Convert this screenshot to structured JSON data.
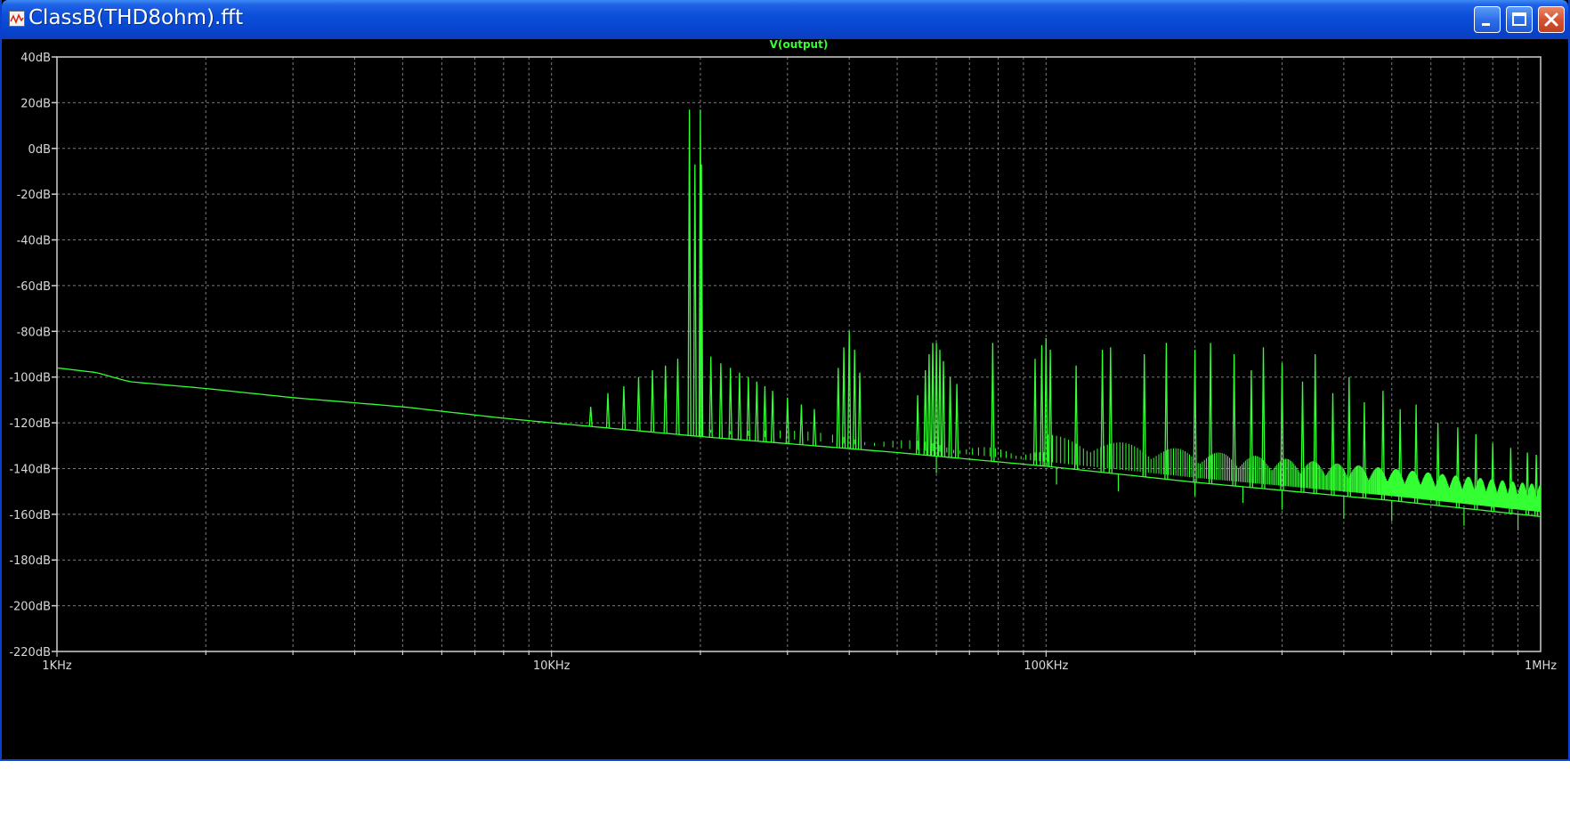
{
  "window": {
    "title": "ClassB(THD8ohm).fft"
  },
  "chart_data": {
    "type": "line",
    "title": "V(output)",
    "xlabel": "",
    "ylabel": "",
    "x_scale": "log",
    "xlim": [
      1000,
      1000000
    ],
    "ylim": [
      -220,
      40
    ],
    "x_ticks": [
      {
        "value": 1000,
        "label": "1KHz"
      },
      {
        "value": 10000,
        "label": "10KHz"
      },
      {
        "value": 100000,
        "label": "100KHz"
      },
      {
        "value": 1000000,
        "label": "1MHz"
      }
    ],
    "y_ticks": [
      {
        "value": 40,
        "label": "40dB"
      },
      {
        "value": 20,
        "label": "20dB"
      },
      {
        "value": 0,
        "label": "0dB"
      },
      {
        "value": -20,
        "label": "-20dB"
      },
      {
        "value": -40,
        "label": "-40dB"
      },
      {
        "value": -60,
        "label": "-60dB"
      },
      {
        "value": -80,
        "label": "-80dB"
      },
      {
        "value": -100,
        "label": "-100dB"
      },
      {
        "value": -120,
        "label": "-120dB"
      },
      {
        "value": -140,
        "label": "-140dB"
      },
      {
        "value": -160,
        "label": "-160dB"
      },
      {
        "value": -180,
        "label": "-180dB"
      },
      {
        "value": -200,
        "label": "-200dB"
      },
      {
        "value": -220,
        "label": "-220dB"
      }
    ],
    "grid": true,
    "series": [
      {
        "name": "V(output)",
        "color": "#33ff33",
        "baseline": [
          [
            1000,
            -96
          ],
          [
            1200,
            -98
          ],
          [
            1400,
            -102
          ],
          [
            2000,
            -105
          ],
          [
            3000,
            -109
          ],
          [
            5000,
            -113
          ],
          [
            8000,
            -118
          ],
          [
            10000,
            -120
          ],
          [
            20000,
            -126
          ],
          [
            50000,
            -133
          ],
          [
            100000,
            -139
          ],
          [
            200000,
            -146
          ],
          [
            500000,
            -154
          ],
          [
            1000000,
            -161
          ]
        ],
        "peaks": [
          [
            19000,
            17
          ],
          [
            20000,
            17
          ],
          [
            19500,
            -7
          ],
          [
            20100,
            -7
          ],
          [
            12000,
            -113
          ],
          [
            13000,
            -107
          ],
          [
            14000,
            -104
          ],
          [
            15000,
            -100
          ],
          [
            16000,
            -97
          ],
          [
            17000,
            -95
          ],
          [
            18000,
            -92
          ],
          [
            21000,
            -91
          ],
          [
            22000,
            -94
          ],
          [
            23000,
            -96
          ],
          [
            24000,
            -98
          ],
          [
            25000,
            -100
          ],
          [
            26000,
            -102
          ],
          [
            27000,
            -104
          ],
          [
            28000,
            -106
          ],
          [
            30000,
            -109
          ],
          [
            32000,
            -112
          ],
          [
            34000,
            -114
          ],
          [
            38000,
            -96
          ],
          [
            39000,
            -87
          ],
          [
            40000,
            -80
          ],
          [
            41000,
            -88
          ],
          [
            42000,
            -98
          ],
          [
            55000,
            -108
          ],
          [
            57000,
            -97
          ],
          [
            58000,
            -90
          ],
          [
            59000,
            -85
          ],
          [
            60000,
            -85
          ],
          [
            61000,
            -88
          ],
          [
            62000,
            -93
          ],
          [
            64000,
            -100
          ],
          [
            66000,
            -103
          ],
          [
            78000,
            -85
          ],
          [
            95000,
            -92
          ],
          [
            98000,
            -86
          ],
          [
            100000,
            -83
          ],
          [
            102000,
            -88
          ],
          [
            115000,
            -95
          ],
          [
            130000,
            -88
          ],
          [
            135000,
            -87
          ],
          [
            158000,
            -90
          ],
          [
            175000,
            -85
          ],
          [
            200000,
            -88
          ],
          [
            215000,
            -85
          ],
          [
            240000,
            -90
          ],
          [
            260000,
            -97
          ],
          [
            275000,
            -87
          ],
          [
            300000,
            -94
          ],
          [
            330000,
            -102
          ],
          [
            350000,
            -90
          ],
          [
            380000,
            -107
          ],
          [
            410000,
            -100
          ],
          [
            440000,
            -111
          ],
          [
            480000,
            -106
          ],
          [
            520000,
            -114
          ],
          [
            560000,
            -112
          ],
          [
            620000,
            -120
          ],
          [
            680000,
            -122
          ],
          [
            740000,
            -125
          ],
          [
            800000,
            -129
          ],
          [
            870000,
            -131
          ],
          [
            940000,
            -133
          ],
          [
            980000,
            -134
          ]
        ],
        "dips": [
          [
            60000,
            -142
          ],
          [
            105000,
            -147
          ],
          [
            140000,
            -150
          ],
          [
            200000,
            -152
          ],
          [
            250000,
            -155
          ],
          [
            300000,
            -158
          ],
          [
            400000,
            -162
          ],
          [
            500000,
            -163
          ],
          [
            700000,
            -165
          ],
          [
            900000,
            -167
          ]
        ]
      }
    ]
  }
}
